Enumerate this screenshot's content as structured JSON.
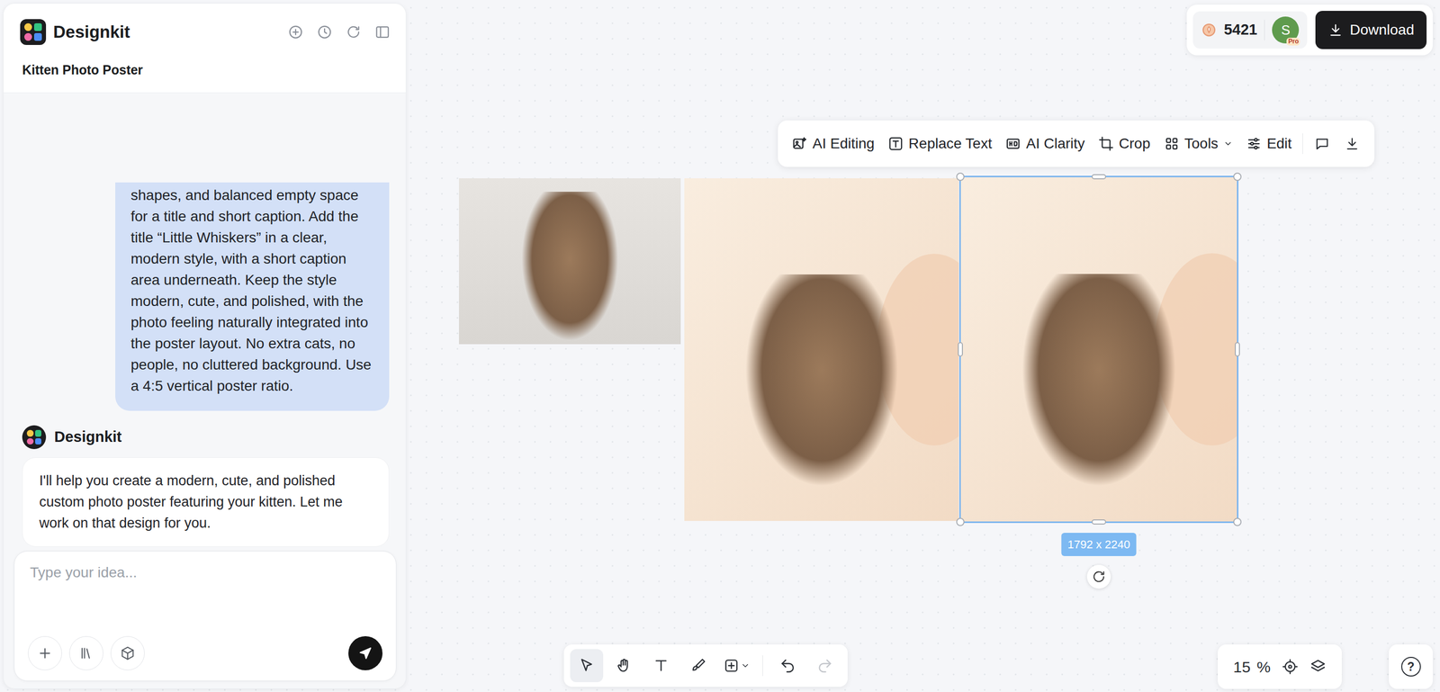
{
  "app": {
    "name": "Designkit",
    "project_title": "Kitten Photo Poster"
  },
  "chat": {
    "messages": [
      {
        "role": "user",
        "text": "shapes, and balanced empty space for a title and short caption. Add the title “Little Whiskers” in a clear, modern style, with a short caption area underneath. Keep the style modern, cute, and polished, with the photo feeling naturally integrated into the poster layout. No extra cats, no people, no cluttered background. Use a 4:5 vertical poster ratio."
      },
      {
        "role": "assistant",
        "sender": "Designkit",
        "text": "I'll help you create a modern, cute, and polished custom photo poster featuring your kitten. Let me work on that design for you."
      }
    ]
  },
  "composer": {
    "placeholder": "Type your idea..."
  },
  "account": {
    "credits": "5421",
    "avatar": "S",
    "badge": "Pro"
  },
  "download": {
    "label": "Download"
  },
  "image_toolbar": {
    "items": [
      {
        "label": "AI Editing",
        "dropdown": false
      },
      {
        "label": "Replace Text",
        "dropdown": false
      },
      {
        "label": "AI Clarity",
        "dropdown": false
      },
      {
        "label": "Crop",
        "dropdown": false
      },
      {
        "label": "Tools",
        "dropdown": true
      },
      {
        "label": "Edit",
        "dropdown": false
      }
    ]
  },
  "canvas": {
    "images": [
      {
        "kind": "photo",
        "selected": false
      },
      {
        "kind": "poster",
        "selected": false
      },
      {
        "kind": "poster",
        "selected": true
      }
    ],
    "selection_size": "1792 x 2240"
  },
  "bottom_toolbar": {
    "tools": [
      {
        "selected": true,
        "disabled": false,
        "dropdown": false
      },
      {
        "selected": false,
        "disabled": false,
        "dropdown": false
      },
      {
        "selected": false,
        "disabled": false,
        "dropdown": false
      },
      {
        "selected": false,
        "disabled": false,
        "dropdown": false
      },
      {
        "selected": false,
        "disabled": false,
        "dropdown": true
      },
      {
        "selected": false,
        "disabled": false,
        "dropdown": false
      },
      {
        "selected": false,
        "disabled": true,
        "dropdown": false
      }
    ]
  },
  "zoom": {
    "value": "15",
    "unit": "%"
  },
  "help": "?"
}
